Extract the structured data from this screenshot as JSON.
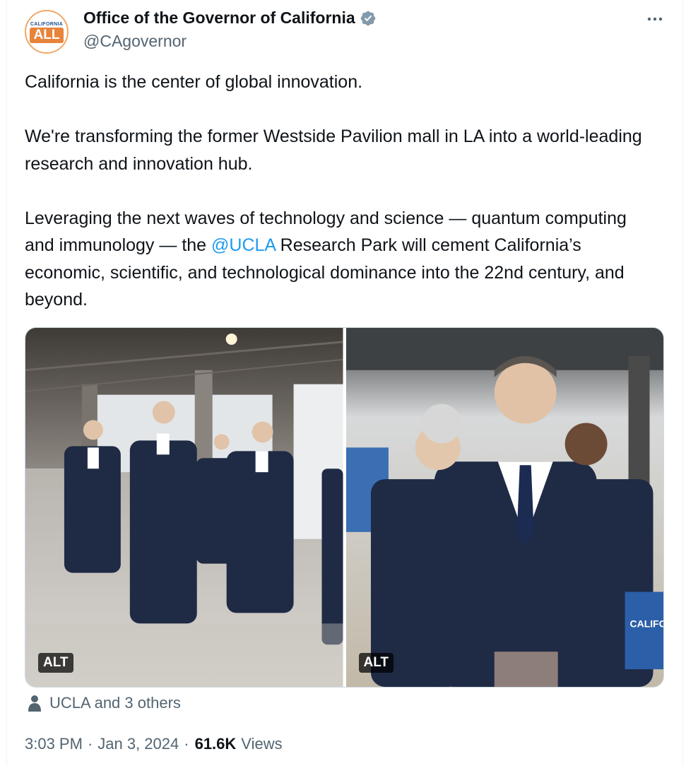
{
  "author": {
    "display_name": "Office of the Governor of California",
    "handle": "@CAgovernor",
    "avatar_top_text": "CALIFORNIA",
    "avatar_main_text": "ALL",
    "verified_icon": "verified-badge-icon",
    "verified_color": "#829aab"
  },
  "tweet": {
    "line1": "California is the center of global innovation.",
    "para2": "We're transforming the former Westside Pavilion mall in LA into a world-leading research and innovation hub.",
    "para3_before": "Leveraging the next waves of technology and science — quantum computing and immunology — the ",
    "para3_mention": "@UCLA",
    "para3_after": " Research Park will cement California’s economic, scientific, and technological dominance into the 22nd century, and beyond."
  },
  "media": {
    "photos": [
      {
        "alt_label": "ALT"
      },
      {
        "alt_label": "ALT",
        "podium_text": "CALIFO"
      }
    ]
  },
  "tagged": {
    "icon": "person-icon",
    "text": "UCLA and 3 others"
  },
  "meta": {
    "time": "3:03 PM",
    "separator": "·",
    "date": "Jan 3, 2024",
    "views_count": "61.6K",
    "views_label": "Views"
  },
  "colors": {
    "link": "#1d9bf0",
    "secondary_text": "#536471",
    "primary_text": "#0f1419"
  }
}
